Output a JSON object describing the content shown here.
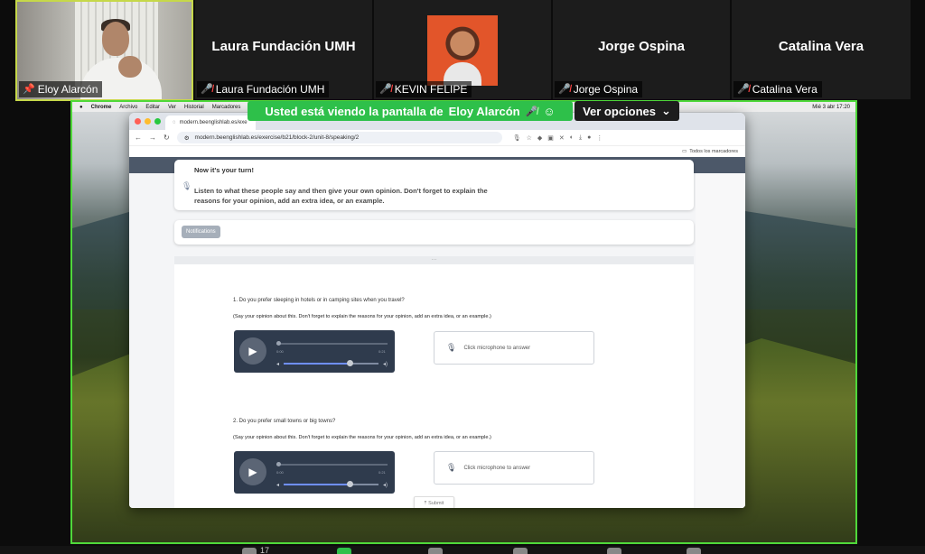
{
  "participants": [
    {
      "tile_name": "",
      "label": "Eloy Alarcón",
      "muted": false
    },
    {
      "tile_name": "Laura Fundación UMH",
      "label": "Laura Fundación UMH",
      "muted": true
    },
    {
      "tile_name": "",
      "label": "KEVIN FELIPE",
      "muted": true
    },
    {
      "tile_name": "Jorge Ospina",
      "label": "Jorge Ospina",
      "muted": true
    },
    {
      "tile_name": "Catalina Vera",
      "label": "Catalina Vera",
      "muted": true
    }
  ],
  "share_banner": {
    "text": "Usted está viendo la pantalla de",
    "presenter": "Eloy Alarcón",
    "view_options": "Ver opciones"
  },
  "macos_menubar": {
    "app": "Chrome",
    "items": [
      "Archivo",
      "Editar",
      "Ver",
      "Historial",
      "Marcadores"
    ],
    "clock": "Mié 3 abr 17:20"
  },
  "browser": {
    "tab_title": "modern.beenglishlab.es/exe",
    "url": "modern.beenglishlab.es/exercise/b21/block-2/unit-8/speaking/2",
    "bookmarks_label": "Todos los marcadores"
  },
  "exercise": {
    "heading": "Now it's your turn!",
    "instructions": "Listen to what these people say and then give your own opinion. Don't forget to explain the reasons for your opinion, add an extra idea, or an example.",
    "notifications_label": "Notifications",
    "drag_handle": "···",
    "questions": [
      {
        "question": "1. Do you prefer sleeping in hotels or in camping sites when you travel?",
        "hint": "(Say your opinion about this. Don't forget to explain the reasons for your opinion, add an extra idea, or an example.)",
        "time_current": "0:00",
        "time_total": "0:21",
        "volume": 0.7,
        "answer_prompt": "Click microphone to answer"
      },
      {
        "question": "2. Do you prefer small towns or big towns?",
        "hint": "(Say your opinion about this. Don't forget to explain the reasons for your opinion, add an extra idea, or an example.)",
        "time_current": "0:00",
        "time_total": "0:21",
        "volume": 0.7,
        "answer_prompt": "Click microphone to answer"
      }
    ],
    "submit_label": "Submit"
  },
  "zoom_toolbar": {
    "participants_count": "17"
  },
  "colors": {
    "share_border": "#4fd83a",
    "banner": "#2ec04a",
    "muted_mic": "#ff4444"
  }
}
